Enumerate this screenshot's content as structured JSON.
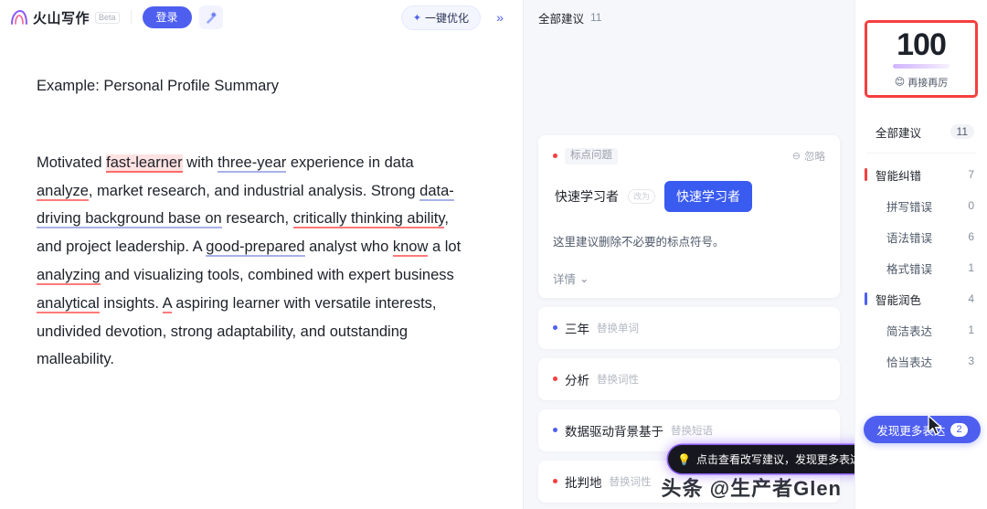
{
  "header": {
    "logo_text": "火山写作",
    "logo_icon": "volcano-logo-icon",
    "beta_tag": "Beta",
    "login_label": "登录",
    "magic_icon": "magic-wand-icon",
    "optimize_label": "一键优化",
    "optimize_icon": "sparkle-icon",
    "collapse_icon": "»"
  },
  "editor": {
    "title": "Example: Personal Profile Summary",
    "paragraph_segments": [
      {
        "text": "Motivated ",
        "style": "plain"
      },
      {
        "text": "fast-learner",
        "style": "error-highlight"
      },
      {
        "text": " with ",
        "style": "plain"
      },
      {
        "text": "three-year",
        "style": "polish"
      },
      {
        "text": " experience in data ",
        "style": "plain"
      },
      {
        "text": "analyze",
        "style": "error"
      },
      {
        "text": ", market research, and industrial analysis. Strong ",
        "style": "plain"
      },
      {
        "text": "data-driving background base on",
        "style": "polish"
      },
      {
        "text": " research, ",
        "style": "plain"
      },
      {
        "text": "critically thinking ability",
        "style": "error"
      },
      {
        "text": ", and project leadership. A ",
        "style": "plain"
      },
      {
        "text": "good-prepared",
        "style": "polish"
      },
      {
        "text": " analyst who ",
        "style": "plain"
      },
      {
        "text": "know",
        "style": "error"
      },
      {
        "text": " a lot ",
        "style": "plain"
      },
      {
        "text": "analyzing",
        "style": "error"
      },
      {
        "text": " and visualizing tools, combined with expert business ",
        "style": "plain"
      },
      {
        "text": "analytical",
        "style": "error"
      },
      {
        "text": " insights. ",
        "style": "plain"
      },
      {
        "text": "A",
        "style": "error"
      },
      {
        "text": " aspiring learner with versatile interests, undivided devotion, strong adaptability, and outstanding malleability.",
        "style": "plain"
      }
    ]
  },
  "suggestions": {
    "header_label": "全部建议",
    "header_count": "11",
    "card": {
      "tag": "标点问题",
      "dot_color": "red",
      "ignore_label": "忽略",
      "ignore_icon": "circle-minus-icon",
      "original_word": "快速学习者",
      "arrow_label": "改为",
      "replacement_word": "快速学习者",
      "description": "这里建议删除不必要的标点符号。",
      "detail_label": "详情",
      "detail_icon": "chevron-down-icon"
    },
    "items": [
      {
        "word": "三年",
        "kind": "替换单词",
        "dot": "blue"
      },
      {
        "word": "分析",
        "kind": "替换词性",
        "dot": "red"
      },
      {
        "word": "数据驱动背景基于",
        "kind": "替换短语",
        "dot": "blue"
      },
      {
        "word": "批判地",
        "kind": "替换词性",
        "dot": "red"
      }
    ],
    "tooltip": {
      "icon": "lightbulb-icon",
      "text": "点击查看改写建议，发现更多表达"
    }
  },
  "sidebar": {
    "score": "100",
    "score_label": "再接再厉",
    "score_emoji": "😊",
    "categories": [
      {
        "name": "全部建议",
        "count": "11",
        "bar": "none",
        "level": "top",
        "pill": true
      },
      {
        "name": "智能纠错",
        "count": "7",
        "bar": "red",
        "level": "top",
        "pill": false
      },
      {
        "name": "拼写错误",
        "count": "0",
        "bar": "none",
        "level": "sub",
        "pill": false
      },
      {
        "name": "语法错误",
        "count": "6",
        "bar": "none",
        "level": "sub",
        "pill": false
      },
      {
        "name": "格式错误",
        "count": "1",
        "bar": "none",
        "level": "sub",
        "pill": false
      },
      {
        "name": "智能润色",
        "count": "4",
        "bar": "blue",
        "level": "top",
        "pill": false
      },
      {
        "name": "简洁表达",
        "count": "1",
        "bar": "none",
        "level": "sub",
        "pill": false
      },
      {
        "name": "恰当表达",
        "count": "3",
        "bar": "none",
        "level": "sub",
        "pill": false
      }
    ],
    "discover_label": "发现更多表达",
    "discover_count": "2"
  },
  "watermark": "头条 @生产者Glen",
  "colors": {
    "accent": "#4e5ff0",
    "error": "#f53f3f",
    "polish": "#a8b2e8",
    "highlight_bg": "#ffe2e2",
    "tooltip_glow": "#8b5cf6"
  }
}
